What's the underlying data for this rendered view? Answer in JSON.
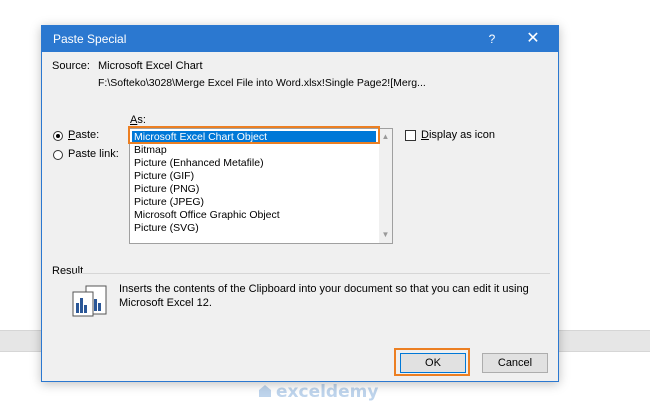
{
  "dialog": {
    "title": "Paste Special",
    "help": "?",
    "close": "✕",
    "source_label": "Source:",
    "source_name": "Microsoft Excel Chart",
    "source_path": "F:\\Softeko\\3028\\Merge Excel File into Word.xlsx!Single Page2![Merg...",
    "as_label": "As:",
    "paste_label": "Paste:",
    "paste_link_label": "Paste link:",
    "paste_selected": true,
    "display_as_icon_label": "Display as icon",
    "display_as_icon_checked": false,
    "formats": [
      "Microsoft Excel Chart Object",
      "Bitmap",
      "Picture (Enhanced Metafile)",
      "Picture (GIF)",
      "Picture (PNG)",
      "Picture (JPEG)",
      "Microsoft Office Graphic Object",
      "Picture (SVG)"
    ],
    "selected_format": "Microsoft Excel Chart Object",
    "result_label": "Result",
    "result_text_line1": "Inserts the contents of the Clipboard into your document so that you can edit it using",
    "result_text_line2": "Microsoft Excel 12.",
    "ok_label": "OK",
    "cancel_label": "Cancel"
  },
  "watermark": {
    "text": "exceldemy"
  },
  "colors": {
    "titlebar": "#2b78d0",
    "highlight": "#ec7f22",
    "selection": "#0078d7"
  }
}
